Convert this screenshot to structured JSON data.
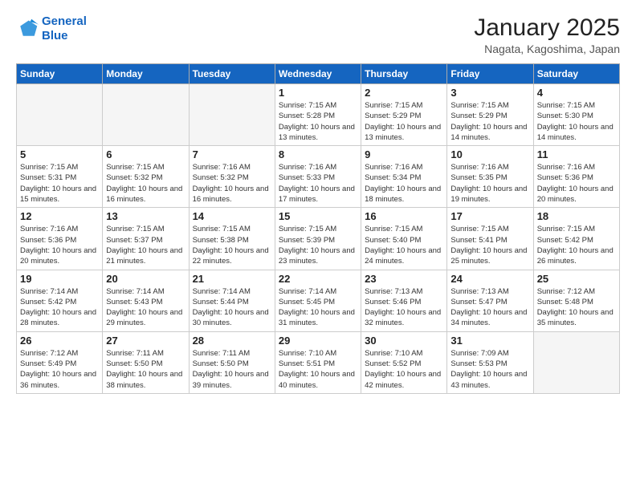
{
  "logo": {
    "line1": "General",
    "line2": "Blue"
  },
  "header": {
    "month": "January 2025",
    "location": "Nagata, Kagoshima, Japan"
  },
  "weekdays": [
    "Sunday",
    "Monday",
    "Tuesday",
    "Wednesday",
    "Thursday",
    "Friday",
    "Saturday"
  ],
  "weeks": [
    [
      {
        "day": "",
        "empty": true
      },
      {
        "day": "",
        "empty": true
      },
      {
        "day": "",
        "empty": true
      },
      {
        "day": "1",
        "sunrise": "7:15 AM",
        "sunset": "5:28 PM",
        "daylight": "10 hours and 13 minutes."
      },
      {
        "day": "2",
        "sunrise": "7:15 AM",
        "sunset": "5:29 PM",
        "daylight": "10 hours and 13 minutes."
      },
      {
        "day": "3",
        "sunrise": "7:15 AM",
        "sunset": "5:29 PM",
        "daylight": "10 hours and 14 minutes."
      },
      {
        "day": "4",
        "sunrise": "7:15 AM",
        "sunset": "5:30 PM",
        "daylight": "10 hours and 14 minutes."
      }
    ],
    [
      {
        "day": "5",
        "sunrise": "7:15 AM",
        "sunset": "5:31 PM",
        "daylight": "10 hours and 15 minutes."
      },
      {
        "day": "6",
        "sunrise": "7:15 AM",
        "sunset": "5:32 PM",
        "daylight": "10 hours and 16 minutes."
      },
      {
        "day": "7",
        "sunrise": "7:16 AM",
        "sunset": "5:32 PM",
        "daylight": "10 hours and 16 minutes."
      },
      {
        "day": "8",
        "sunrise": "7:16 AM",
        "sunset": "5:33 PM",
        "daylight": "10 hours and 17 minutes."
      },
      {
        "day": "9",
        "sunrise": "7:16 AM",
        "sunset": "5:34 PM",
        "daylight": "10 hours and 18 minutes."
      },
      {
        "day": "10",
        "sunrise": "7:16 AM",
        "sunset": "5:35 PM",
        "daylight": "10 hours and 19 minutes."
      },
      {
        "day": "11",
        "sunrise": "7:16 AM",
        "sunset": "5:36 PM",
        "daylight": "10 hours and 20 minutes."
      }
    ],
    [
      {
        "day": "12",
        "sunrise": "7:16 AM",
        "sunset": "5:36 PM",
        "daylight": "10 hours and 20 minutes."
      },
      {
        "day": "13",
        "sunrise": "7:15 AM",
        "sunset": "5:37 PM",
        "daylight": "10 hours and 21 minutes."
      },
      {
        "day": "14",
        "sunrise": "7:15 AM",
        "sunset": "5:38 PM",
        "daylight": "10 hours and 22 minutes."
      },
      {
        "day": "15",
        "sunrise": "7:15 AM",
        "sunset": "5:39 PM",
        "daylight": "10 hours and 23 minutes."
      },
      {
        "day": "16",
        "sunrise": "7:15 AM",
        "sunset": "5:40 PM",
        "daylight": "10 hours and 24 minutes."
      },
      {
        "day": "17",
        "sunrise": "7:15 AM",
        "sunset": "5:41 PM",
        "daylight": "10 hours and 25 minutes."
      },
      {
        "day": "18",
        "sunrise": "7:15 AM",
        "sunset": "5:42 PM",
        "daylight": "10 hours and 26 minutes."
      }
    ],
    [
      {
        "day": "19",
        "sunrise": "7:14 AM",
        "sunset": "5:42 PM",
        "daylight": "10 hours and 28 minutes."
      },
      {
        "day": "20",
        "sunrise": "7:14 AM",
        "sunset": "5:43 PM",
        "daylight": "10 hours and 29 minutes."
      },
      {
        "day": "21",
        "sunrise": "7:14 AM",
        "sunset": "5:44 PM",
        "daylight": "10 hours and 30 minutes."
      },
      {
        "day": "22",
        "sunrise": "7:14 AM",
        "sunset": "5:45 PM",
        "daylight": "10 hours and 31 minutes."
      },
      {
        "day": "23",
        "sunrise": "7:13 AM",
        "sunset": "5:46 PM",
        "daylight": "10 hours and 32 minutes."
      },
      {
        "day": "24",
        "sunrise": "7:13 AM",
        "sunset": "5:47 PM",
        "daylight": "10 hours and 34 minutes."
      },
      {
        "day": "25",
        "sunrise": "7:12 AM",
        "sunset": "5:48 PM",
        "daylight": "10 hours and 35 minutes."
      }
    ],
    [
      {
        "day": "26",
        "sunrise": "7:12 AM",
        "sunset": "5:49 PM",
        "daylight": "10 hours and 36 minutes."
      },
      {
        "day": "27",
        "sunrise": "7:11 AM",
        "sunset": "5:50 PM",
        "daylight": "10 hours and 38 minutes."
      },
      {
        "day": "28",
        "sunrise": "7:11 AM",
        "sunset": "5:50 PM",
        "daylight": "10 hours and 39 minutes."
      },
      {
        "day": "29",
        "sunrise": "7:10 AM",
        "sunset": "5:51 PM",
        "daylight": "10 hours and 40 minutes."
      },
      {
        "day": "30",
        "sunrise": "7:10 AM",
        "sunset": "5:52 PM",
        "daylight": "10 hours and 42 minutes."
      },
      {
        "day": "31",
        "sunrise": "7:09 AM",
        "sunset": "5:53 PM",
        "daylight": "10 hours and 43 minutes."
      },
      {
        "day": "",
        "empty": true
      }
    ]
  ]
}
